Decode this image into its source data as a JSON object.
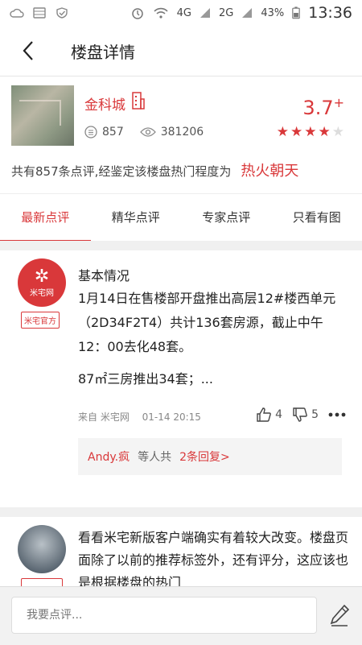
{
  "status_bar": {
    "battery": "43%",
    "time": "13:36",
    "network_1": "4G",
    "network_2": "4G",
    "network_3": "2G"
  },
  "header": {
    "title": "楼盘详情"
  },
  "property": {
    "name": "金科城",
    "comments_count": "857",
    "views": "381206",
    "score": "3.7",
    "score_suffix": "+",
    "rating": 4,
    "rating_max": 5,
    "heat_text": "共有857条点评,经鉴定该楼盘热门程度为",
    "heat_level": "热火朝天"
  },
  "tabs": [
    {
      "label": "最新点评",
      "active": true
    },
    {
      "label": "精华点评",
      "active": false
    },
    {
      "label": "专家点评",
      "active": false
    },
    {
      "label": "只看有图",
      "active": false
    }
  ],
  "review1": {
    "avatar_text": "米宅网",
    "badge": "米宅官方",
    "title": "基本情况",
    "body": "1月14日在售楼部开盘推出高层12#楼西单元（2D34F2T4）共计136套房源，截止中午12：00去化48套。",
    "more": "87㎡三房推出34套；...",
    "source": "来自 米宅网",
    "date": "01-14 20:15",
    "likes": "4",
    "dislikes": "5",
    "reply_user": "Andy.疯",
    "reply_mid": "等人共",
    "reply_count": "2条回复>"
  },
  "review2": {
    "body": "看看米宅新版客户端确实有着较大改变。楼盘页面除了以前的推荐标签外，还有评分，这应该也是根据楼盘的热门"
  },
  "bottom": {
    "placeholder": "我要点评..."
  },
  "colors": {
    "accent": "#d9383a",
    "divider": "#f0f0f0"
  }
}
